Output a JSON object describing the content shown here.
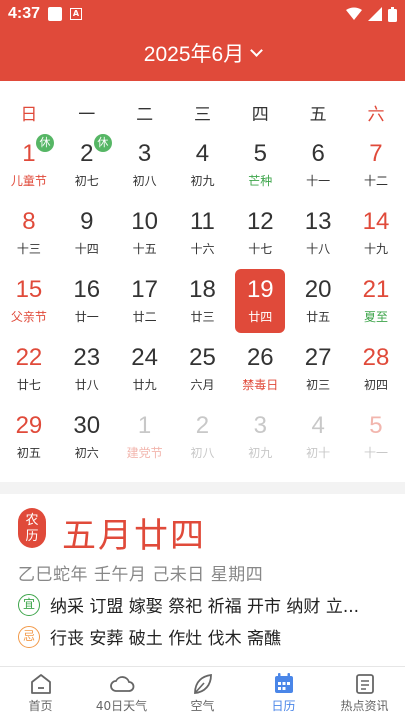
{
  "status_bar": {
    "time": "4:37"
  },
  "header": {
    "month_title": "2025年6月"
  },
  "week_days": [
    "日",
    "一",
    "二",
    "三",
    "四",
    "五",
    "六"
  ],
  "calendar": {
    "rows": [
      [
        {
          "d": "1",
          "l": "儿童节",
          "badge": "休",
          "lred": true,
          "wk": true
        },
        {
          "d": "2",
          "l": "初七",
          "badge": "休"
        },
        {
          "d": "3",
          "l": "初八"
        },
        {
          "d": "4",
          "l": "初九"
        },
        {
          "d": "5",
          "l": "芒种",
          "lgreen": true
        },
        {
          "d": "6",
          "l": "十一"
        },
        {
          "d": "7",
          "l": "十二",
          "wk": true
        }
      ],
      [
        {
          "d": "8",
          "l": "十三",
          "wk": true
        },
        {
          "d": "9",
          "l": "十四"
        },
        {
          "d": "10",
          "l": "十五"
        },
        {
          "d": "11",
          "l": "十六"
        },
        {
          "d": "12",
          "l": "十七"
        },
        {
          "d": "13",
          "l": "十八"
        },
        {
          "d": "14",
          "l": "十九",
          "wk": true
        }
      ],
      [
        {
          "d": "15",
          "l": "父亲节",
          "lred": true,
          "wk": true
        },
        {
          "d": "16",
          "l": "廿一"
        },
        {
          "d": "17",
          "l": "廿二"
        },
        {
          "d": "18",
          "l": "廿三"
        },
        {
          "d": "19",
          "l": "廿四",
          "selected": true
        },
        {
          "d": "20",
          "l": "廿五"
        },
        {
          "d": "21",
          "l": "夏至",
          "lgreen": true,
          "wk": true
        }
      ],
      [
        {
          "d": "22",
          "l": "廿七",
          "wk": true
        },
        {
          "d": "23",
          "l": "廿八"
        },
        {
          "d": "24",
          "l": "廿九"
        },
        {
          "d": "25",
          "l": "六月"
        },
        {
          "d": "26",
          "l": "禁毒日",
          "lred": true
        },
        {
          "d": "27",
          "l": "初三"
        },
        {
          "d": "28",
          "l": "初四",
          "wk": true
        }
      ],
      [
        {
          "d": "29",
          "l": "初五",
          "wk": true
        },
        {
          "d": "30",
          "l": "初六"
        },
        {
          "d": "1",
          "l": "建党节",
          "dim": true,
          "lred": true
        },
        {
          "d": "2",
          "l": "初八",
          "dim": true
        },
        {
          "d": "3",
          "l": "初九",
          "dim": true
        },
        {
          "d": "4",
          "l": "初十",
          "dim": true
        },
        {
          "d": "5",
          "l": "十一",
          "dim": true,
          "wk": true
        }
      ]
    ]
  },
  "detail": {
    "seal_top": "农",
    "seal_bottom": "历",
    "lunar_date": "五月廿四",
    "ganzhi": "乙巳蛇年 壬午月 己未日 星期四",
    "yi_label": "宜",
    "yi_text": "纳采 订盟 嫁娶 祭祀 祈福 开市 纳财 立...",
    "ji_label": "忌",
    "ji_text": "行丧 安葬 破土 作灶 伐木 斋醮"
  },
  "nav": [
    {
      "label": "首页",
      "icon": "home-icon"
    },
    {
      "label": "40日天气",
      "icon": "cloud-icon"
    },
    {
      "label": "空气",
      "icon": "leaf-icon"
    },
    {
      "label": "日历",
      "icon": "calendar-icon",
      "active": true
    },
    {
      "label": "热点资讯",
      "icon": "news-icon"
    }
  ],
  "colors": {
    "accent": "#e04a3a",
    "nav_active": "#4a86e8",
    "holiday_badge": "#56b665"
  }
}
